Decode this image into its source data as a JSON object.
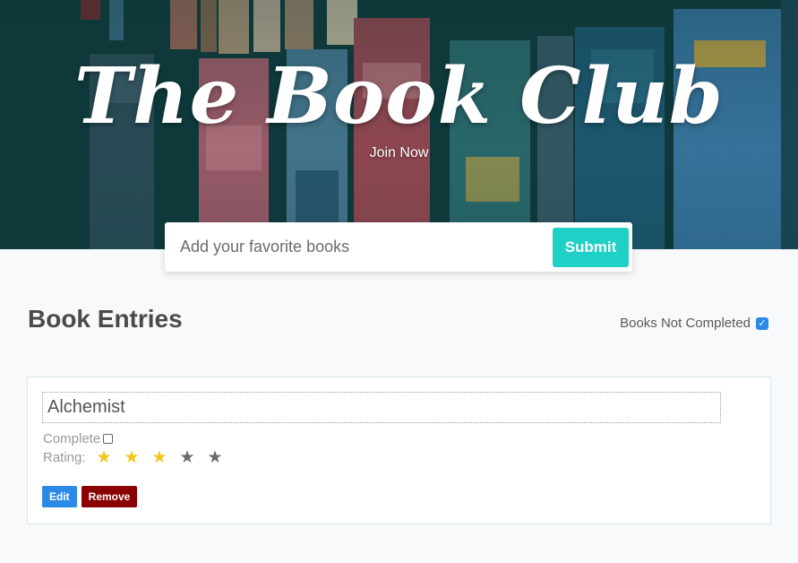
{
  "hero": {
    "title": "The Book Club",
    "join_label": "Join Now"
  },
  "add_book": {
    "placeholder": "Add your favorite books",
    "submit_label": "Submit"
  },
  "section": {
    "title": "Book Entries",
    "filter_label": "Books Not Completed",
    "filter_checked": true
  },
  "books": [
    {
      "title": "Alchemist",
      "complete_label": "Complete",
      "complete": false,
      "rating_label": "Rating:",
      "rating": 3,
      "rating_max": 5,
      "edit_label": "Edit",
      "remove_label": "Remove"
    }
  ],
  "colors": {
    "accent": "#1ed0c6",
    "edit": "#2b8ae8",
    "remove": "#8b0000",
    "star_on": "#f5c518",
    "star_off": "#6b6b6b"
  }
}
